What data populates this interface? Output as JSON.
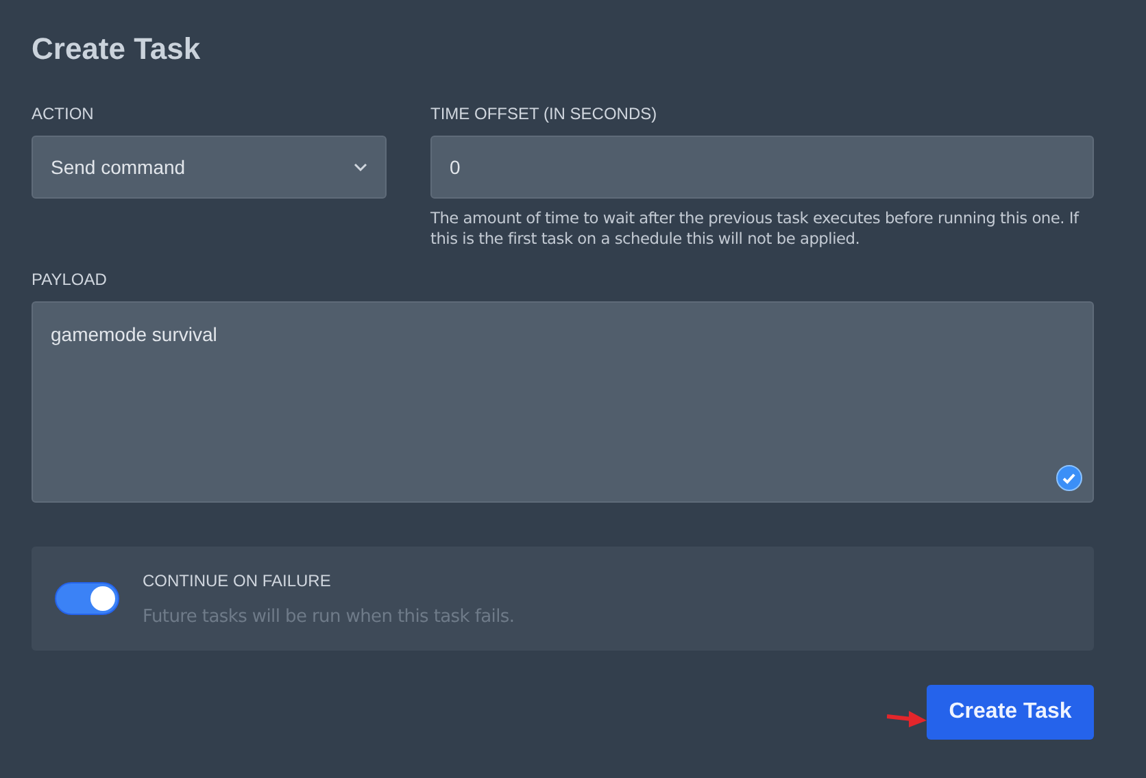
{
  "title": "Create Task",
  "action": {
    "label": "ACTION",
    "value": "Send command"
  },
  "time_offset": {
    "label": "TIME OFFSET (IN SECONDS)",
    "value": "0",
    "help": "The amount of time to wait after the previous task executes before running this one. If this is the first task on a schedule this will not be applied."
  },
  "payload": {
    "label": "PAYLOAD",
    "value": "gamemode survival"
  },
  "continue_on_failure": {
    "label": "CONTINUE ON FAILURE",
    "description": "Future tasks will be run when this task fails.",
    "on": true
  },
  "submit_button": "Create Task"
}
